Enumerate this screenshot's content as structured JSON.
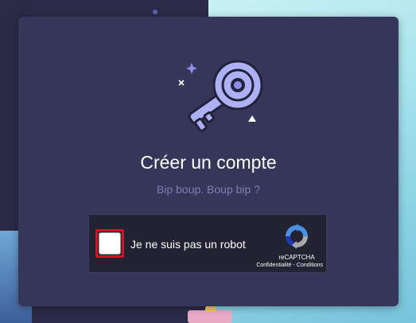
{
  "modal": {
    "title": "Créer un compte",
    "subtitle": "Bip boup. Boup bip ?",
    "illustration": "key-icon"
  },
  "recaptcha": {
    "checkbox_label": "Je ne suis pas un robot",
    "checked": false,
    "brand": "reCAPTCHA",
    "privacy_link": "Confidentialité",
    "separator": " - ",
    "terms_link": "Conditions",
    "highlight_color": "#d11424"
  },
  "colors": {
    "card_bg": "#36365a",
    "accent": "#8e8ef0",
    "subtitle": "#7d7fb0"
  }
}
